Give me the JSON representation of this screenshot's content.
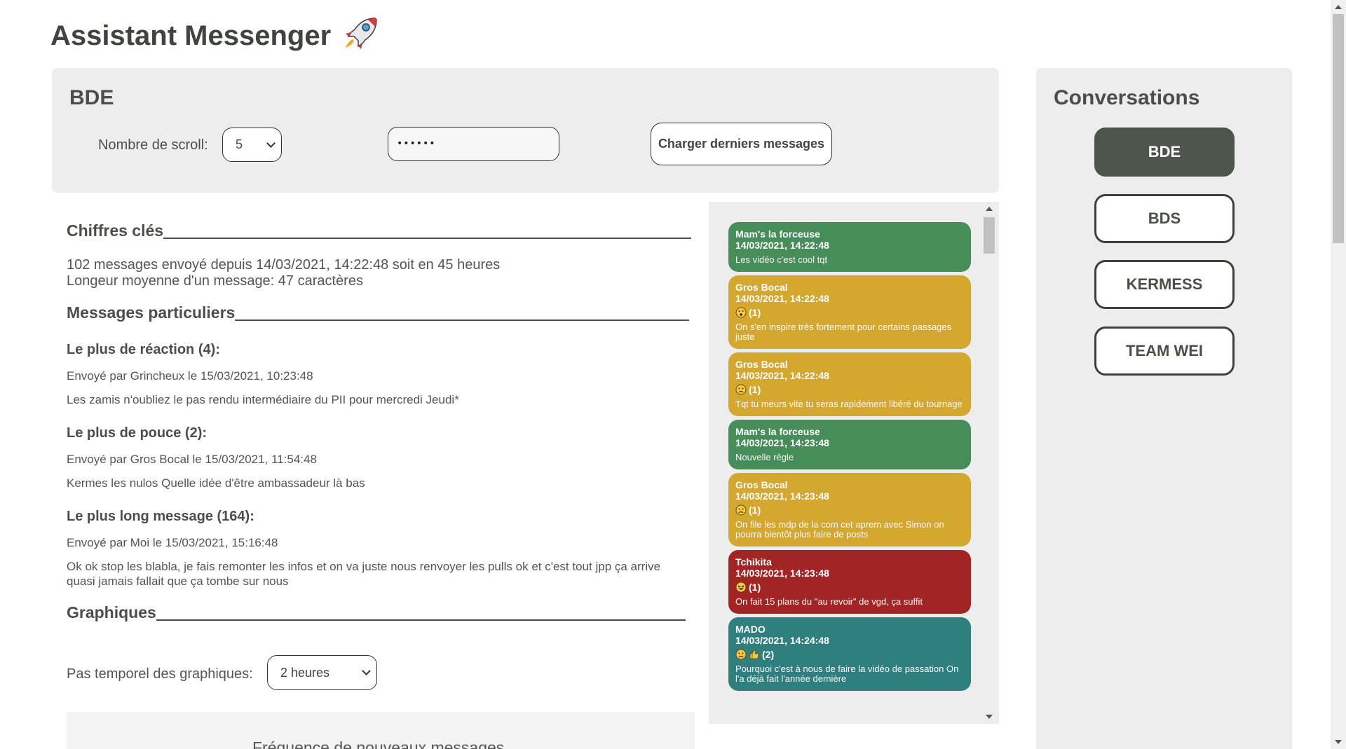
{
  "app": {
    "title": "Assistant Messenger"
  },
  "top_panel": {
    "conversation_title": "BDE",
    "scroll_label": "Nombre de scroll:",
    "scroll_value": "5",
    "password_mask": "••••••",
    "load_button": "Charger derniers messages"
  },
  "stats": {
    "key_figures_heading": "Chiffres clés",
    "messages_count_line": "102 messages envoyé depuis 14/03/2021, 14:22:48 soit en 45 heures",
    "avg_length_line": "Longeur moyenne d'un message: 47 caractères",
    "special_heading": "Messages particuliers",
    "most_reactions": {
      "heading": "Le plus de réaction (4):",
      "sent_by": "Envoyé par Grincheux le 15/03/2021, 10:23:48",
      "text": "Les zamis n'oubliez le pas rendu intermédiaire du PII pour mercredi Jeudi*"
    },
    "most_thumbs": {
      "heading": "Le plus de pouce (2):",
      "sent_by": "Envoyé par Gros Bocal le 15/03/2021, 11:54:48",
      "text": "Kermes les nulos Quelle idée d'être ambassadeur là bas"
    },
    "longest": {
      "heading": "Le plus long message (164):",
      "sent_by": "Envoyé par Moi le 15/03/2021, 15:16:48",
      "text": "Ok ok stop les blabla, je fais remonter les infos et on va juste nous renvoyer les pulls ok et c'est tout jpp ça arrive quasi jamais fallait que ça tombe sur nous"
    },
    "graphs_heading": "Graphiques",
    "time_step_label": "Pas temporel des graphiques:",
    "time_step_value": "2 heures",
    "graph_title": "Fréquence de nouveaux messages"
  },
  "messages": [
    {
      "author": "Mam's la forceuse",
      "time": "14/03/2021, 14:22:48",
      "reactions": "",
      "reaction_icons": [],
      "text": "Les vidéo c'est cool tqt",
      "color": "#468d5a"
    },
    {
      "author": "Gros Bocal",
      "time": "14/03/2021, 14:22:48",
      "reactions": "(1)",
      "reaction_icons": [
        "surprised-emoji-icon"
      ],
      "text": "On s'en inspire très fortement pour certains passages juste",
      "color": "#d4a72e"
    },
    {
      "author": "Gros Bocal",
      "time": "14/03/2021, 14:22:48",
      "reactions": "(1)",
      "reaction_icons": [
        "sad-emoji-icon"
      ],
      "text": "Tqt tu meurs vite tu seras rapidement libéré du tournage",
      "color": "#d4a72e"
    },
    {
      "author": "Mam's la forceuse",
      "time": "14/03/2021, 14:23:48",
      "reactions": "",
      "reaction_icons": [],
      "text": "Nouvelle règle",
      "color": "#468d5a"
    },
    {
      "author": "Gros Bocal",
      "time": "14/03/2021, 14:23:48",
      "reactions": "(1)",
      "reaction_icons": [
        "sad-emoji-icon"
      ],
      "text": "On file les mdp de la com cet aprem avec Simon on pourra bientôt plus faire de posts",
      "color": "#d4a72e"
    },
    {
      "author": "Tchikita",
      "time": "14/03/2021, 14:23:48",
      "reactions": "(1)",
      "reaction_icons": [
        "laughing-emoji-icon"
      ],
      "text": "On fait 15 plans du \"au revoir\" de vgd, ça suffit",
      "color": "#a32424"
    },
    {
      "author": "MADO",
      "time": "14/03/2021, 14:24:48",
      "reactions": "(2)",
      "reaction_icons": [
        "sad-emoji-icon",
        "thumbs-up-icon"
      ],
      "text": "Pourquoi c'est à nous de faire la vidéo de passation On l'a déjà fait l'année dernière",
      "color": "#2f7f7f"
    }
  ],
  "conversations": {
    "title": "Conversations",
    "items": [
      "BDE",
      "BDS",
      "KERMESS",
      "TEAM WEI"
    ],
    "active": "BDE"
  }
}
